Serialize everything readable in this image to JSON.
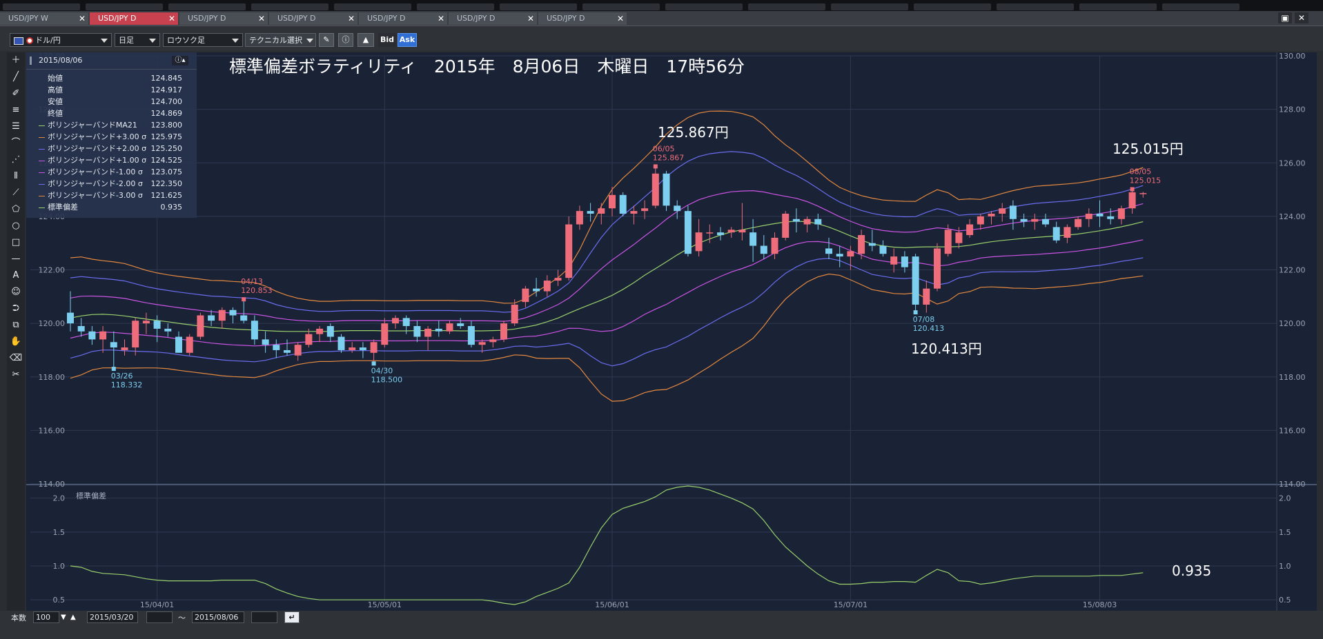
{
  "tabs": [
    {
      "label": "USD/JPY W",
      "active": false
    },
    {
      "label": "USD/JPY D",
      "active": true
    },
    {
      "label": "USD/JPY D",
      "active": false
    },
    {
      "label": "USD/JPY D",
      "active": false
    },
    {
      "label": "USD/JPY D",
      "active": false
    },
    {
      "label": "USD/JPY D",
      "active": false
    },
    {
      "label": "USD/JPY D",
      "active": false
    }
  ],
  "toolbar": {
    "pair": "ドル/円",
    "period": "日足",
    "chart_style": "ロウソク足",
    "technical": "テクニカル選択",
    "bid": "Bid",
    "ask": "Ask"
  },
  "info": {
    "date": "2015/08/06",
    "rows": [
      {
        "label": "始値",
        "value": "124.845",
        "color": ""
      },
      {
        "label": "高値",
        "value": "124.917",
        "color": ""
      },
      {
        "label": "安値",
        "value": "124.700",
        "color": ""
      },
      {
        "label": "終値",
        "value": "124.869",
        "color": ""
      },
      {
        "label": "ボリンジャーバンドMA21",
        "value": "123.800",
        "color": "#9ad16b"
      },
      {
        "label": "ボリンジャーバンド+3.00 σ",
        "value": "125.975",
        "color": "#e68a3f"
      },
      {
        "label": "ボリンジャーバンド+2.00 σ",
        "value": "125.250",
        "color": "#6b6ef0"
      },
      {
        "label": "ボリンジャーバンド+1.00 σ",
        "value": "124.525",
        "color": "#cc55e6"
      },
      {
        "label": "ボリンジャーバンド-1.00 σ",
        "value": "123.075",
        "color": "#cc55e6"
      },
      {
        "label": "ボリンジャーバンド-2.00 σ",
        "value": "122.350",
        "color": "#6b6ef0"
      },
      {
        "label": "ボリンジャーバンド-3.00 σ",
        "value": "121.625",
        "color": "#e68a3f"
      },
      {
        "label": "標準偏差",
        "value": "0.935",
        "color": "#9ad16b"
      }
    ]
  },
  "headline": "標準偏差ボラティリティ　2015年　8月06日　木曜日　17時56分",
  "sub_label": "標準偏差",
  "callouts": {
    "high_big": "125.867円",
    "recent_big": "125.015円",
    "low_big": "120.413円",
    "sd_big": "0.935"
  },
  "bottom": {
    "count_label": "本数",
    "count_value": "100",
    "from_date": "2015/03/20",
    "tilde": "〜",
    "to_date": "2015/08/06"
  },
  "colors": {
    "up": "#ef6d7a",
    "down": "#7ccfee",
    "ma": "#9ad16b",
    "sigma3": "#e68a3f",
    "sigma2": "#6b6ef0",
    "sigma1": "#cc55e6",
    "bg": "#1a2236",
    "grid": "#2e3850"
  },
  "chart_data": [
    {
      "type": "candlestick",
      "title": "標準偏差ボラティリティ　2015年　8月06日　木曜日　17時56分",
      "ylim": [
        114,
        130
      ],
      "y_ticks": [
        "130.00",
        "128.00",
        "126.00",
        "124.00",
        "122.00",
        "120.00",
        "118.00",
        "116.00",
        "114.00"
      ],
      "x_ticks": [
        {
          "index": 8,
          "label": "15/04/01"
        },
        {
          "index": 29,
          "label": "15/05/01"
        },
        {
          "index": 50,
          "label": "15/06/01"
        },
        {
          "index": 72,
          "label": "15/07/01"
        },
        {
          "index": 95,
          "label": "15/08/03"
        }
      ],
      "ohlc": [
        [
          120.4,
          121.2,
          119.7,
          120.0
        ],
        [
          119.9,
          120.2,
          119.5,
          119.7
        ],
        [
          119.7,
          119.9,
          119.2,
          119.4
        ],
        [
          119.4,
          119.9,
          118.9,
          119.7
        ],
        [
          119.3,
          119.7,
          118.3,
          119.1
        ],
        [
          119.0,
          119.4,
          118.8,
          119.1
        ],
        [
          119.1,
          120.2,
          118.8,
          120.1
        ],
        [
          120.0,
          120.4,
          119.6,
          120.1
        ],
        [
          120.1,
          120.3,
          119.3,
          119.8
        ],
        [
          119.8,
          120.0,
          119.5,
          119.7
        ],
        [
          119.5,
          119.7,
          118.9,
          118.9
        ],
        [
          118.9,
          119.6,
          118.8,
          119.5
        ],
        [
          119.5,
          120.4,
          119.4,
          120.3
        ],
        [
          120.3,
          120.5,
          119.9,
          120.1
        ],
        [
          120.1,
          120.6,
          119.8,
          120.5
        ],
        [
          120.5,
          120.6,
          120.0,
          120.3
        ],
        [
          120.3,
          120.9,
          120.0,
          120.1
        ],
        [
          120.1,
          120.3,
          119.2,
          119.4
        ],
        [
          119.4,
          119.7,
          118.9,
          119.2
        ],
        [
          119.2,
          119.4,
          118.7,
          119.0
        ],
        [
          119.0,
          119.4,
          118.8,
          118.9
        ],
        [
          118.8,
          119.3,
          118.6,
          119.2
        ],
        [
          119.2,
          119.8,
          119.1,
          119.6
        ],
        [
          119.6,
          119.9,
          119.3,
          119.8
        ],
        [
          119.9,
          120.0,
          119.3,
          119.5
        ],
        [
          119.5,
          119.6,
          118.9,
          119.0
        ],
        [
          119.0,
          119.3,
          118.9,
          119.1
        ],
        [
          119.1,
          119.3,
          118.7,
          119.0
        ],
        [
          118.9,
          119.4,
          118.5,
          119.3
        ],
        [
          119.2,
          120.2,
          119.1,
          120.0
        ],
        [
          120.0,
          120.3,
          119.8,
          120.2
        ],
        [
          120.2,
          120.3,
          119.6,
          119.9
        ],
        [
          119.9,
          120.1,
          119.3,
          119.5
        ],
        [
          119.5,
          119.9,
          119.0,
          119.8
        ],
        [
          119.8,
          120.1,
          119.5,
          119.7
        ],
        [
          119.7,
          120.1,
          119.6,
          120.0
        ],
        [
          120.0,
          120.2,
          119.8,
          119.9
        ],
        [
          119.9,
          120.1,
          119.1,
          119.2
        ],
        [
          119.2,
          119.4,
          118.9,
          119.3
        ],
        [
          119.3,
          119.5,
          119.1,
          119.4
        ],
        [
          119.4,
          120.1,
          119.3,
          120.0
        ],
        [
          120.0,
          120.9,
          119.9,
          120.7
        ],
        [
          120.8,
          121.4,
          120.6,
          121.3
        ],
        [
          121.3,
          121.7,
          121.0,
          121.2
        ],
        [
          121.2,
          121.8,
          121.0,
          121.6
        ],
        [
          121.6,
          122.0,
          121.4,
          121.7
        ],
        [
          121.7,
          124.0,
          121.6,
          123.7
        ],
        [
          123.7,
          124.4,
          123.5,
          124.2
        ],
        [
          124.2,
          124.5,
          123.8,
          124.1
        ],
        [
          124.1,
          124.5,
          123.7,
          124.3
        ],
        [
          124.3,
          125.1,
          124.0,
          124.8
        ],
        [
          124.8,
          124.9,
          124.0,
          124.1
        ],
        [
          124.1,
          124.4,
          123.7,
          124.2
        ],
        [
          124.2,
          124.6,
          123.9,
          124.3
        ],
        [
          124.4,
          125.867,
          124.3,
          125.6
        ],
        [
          125.6,
          125.7,
          124.2,
          124.4
        ],
        [
          124.4,
          124.6,
          123.9,
          124.2
        ],
        [
          124.2,
          124.4,
          122.5,
          122.6
        ],
        [
          122.7,
          123.9,
          122.5,
          123.4
        ],
        [
          123.4,
          123.7,
          123.0,
          123.4
        ],
        [
          123.4,
          123.6,
          123.1,
          123.3
        ],
        [
          123.4,
          123.6,
          123.2,
          123.5
        ],
        [
          123.4,
          124.5,
          123.1,
          123.5
        ],
        [
          123.4,
          123.9,
          122.3,
          122.9
        ],
        [
          122.9,
          123.3,
          122.4,
          122.6
        ],
        [
          122.6,
          123.4,
          122.4,
          123.2
        ],
        [
          123.2,
          124.2,
          123.1,
          124.1
        ],
        [
          123.9,
          124.3,
          123.4,
          123.8
        ],
        [
          123.7,
          124.0,
          123.4,
          123.9
        ],
        [
          123.9,
          124.1,
          123.5,
          123.7
        ],
        [
          122.8,
          123.2,
          122.4,
          122.6
        ],
        [
          122.6,
          122.9,
          122.1,
          122.5
        ],
        [
          122.5,
          122.9,
          122.0,
          122.7
        ],
        [
          122.6,
          123.5,
          122.4,
          123.3
        ],
        [
          123.0,
          123.5,
          122.7,
          122.9
        ],
        [
          122.9,
          123.1,
          122.5,
          122.6
        ],
        [
          122.2,
          122.8,
          121.9,
          122.5
        ],
        [
          122.5,
          122.7,
          121.9,
          122.1
        ],
        [
          122.5,
          122.6,
          120.413,
          120.7
        ],
        [
          120.7,
          121.6,
          120.4,
          121.3
        ],
        [
          121.3,
          123.0,
          121.2,
          122.8
        ],
        [
          122.6,
          123.7,
          122.5,
          123.5
        ],
        [
          123.0,
          123.6,
          122.8,
          123.4
        ],
        [
          123.3,
          123.9,
          123.2,
          123.7
        ],
        [
          123.7,
          124.1,
          123.5,
          124.0
        ],
        [
          124.0,
          124.2,
          123.7,
          124.1
        ],
        [
          124.1,
          124.5,
          123.8,
          124.3
        ],
        [
          124.4,
          124.6,
          123.5,
          123.9
        ],
        [
          123.9,
          124.1,
          123.6,
          123.8
        ],
        [
          123.8,
          124.1,
          123.5,
          123.9
        ],
        [
          123.9,
          124.1,
          123.6,
          123.7
        ],
        [
          123.6,
          123.8,
          123.0,
          123.1
        ],
        [
          123.2,
          123.7,
          123.0,
          123.6
        ],
        [
          123.6,
          124.0,
          123.5,
          123.9
        ],
        [
          123.9,
          124.3,
          123.6,
          124.1
        ],
        [
          124.1,
          124.6,
          123.6,
          124.0
        ],
        [
          124.0,
          124.3,
          123.7,
          123.9
        ],
        [
          123.9,
          124.4,
          123.7,
          124.3
        ],
        [
          124.3,
          125.015,
          124.1,
          124.9
        ],
        [
          124.845,
          124.917,
          124.7,
          124.869
        ]
      ],
      "bands": {
        "ma21": [
          120.2,
          120.28,
          120.33,
          120.34,
          120.32,
          120.28,
          120.22,
          120.16,
          120.11,
          120.06,
          120.0,
          119.95,
          119.9,
          119.85,
          119.82,
          119.79,
          119.77,
          119.75,
          119.73,
          119.71,
          119.7,
          119.7,
          119.7,
          119.7,
          119.7,
          119.72,
          119.73,
          119.73,
          119.73,
          119.72,
          119.72,
          119.72,
          119.73,
          119.73,
          119.73,
          119.73,
          119.72,
          119.72,
          119.72,
          119.73,
          119.74,
          119.79,
          119.86,
          119.94,
          120.06,
          120.2,
          120.38,
          120.55,
          120.71,
          120.87,
          121.05,
          121.27,
          121.52,
          121.8,
          122.05,
          122.3,
          122.56,
          122.79,
          123.0,
          123.16,
          123.3,
          123.42,
          123.5,
          123.58,
          123.66,
          123.73,
          123.79,
          123.82,
          123.8,
          123.72,
          123.6,
          123.44,
          123.27,
          123.11,
          122.97,
          122.9,
          122.85,
          122.83,
          122.85,
          122.86,
          122.86,
          122.86,
          122.87,
          122.92,
          122.99,
          123.05,
          123.1,
          123.14,
          123.18,
          123.21,
          123.24,
          123.27,
          123.3,
          123.34,
          123.4,
          123.46,
          123.53,
          123.61,
          123.7,
          123.8
        ],
        "sd": [
          1.0,
          0.98,
          0.92,
          0.89,
          0.88,
          0.87,
          0.84,
          0.81,
          0.79,
          0.78,
          0.78,
          0.78,
          0.78,
          0.78,
          0.79,
          0.79,
          0.79,
          0.79,
          0.74,
          0.66,
          0.6,
          0.55,
          0.52,
          0.5,
          0.5,
          0.5,
          0.5,
          0.5,
          0.5,
          0.5,
          0.5,
          0.5,
          0.5,
          0.5,
          0.5,
          0.5,
          0.5,
          0.5,
          0.5,
          0.48,
          0.45,
          0.43,
          0.47,
          0.55,
          0.61,
          0.67,
          0.75,
          0.98,
          1.28,
          1.56,
          1.76,
          1.85,
          1.9,
          1.95,
          2.02,
          2.12,
          2.16,
          2.18,
          2.16,
          2.12,
          2.06,
          2.0,
          1.93,
          1.84,
          1.67,
          1.46,
          1.28,
          1.14,
          1.0,
          0.88,
          0.78,
          0.73,
          0.73,
          0.74,
          0.76,
          0.76,
          0.77,
          0.77,
          0.76,
          0.86,
          0.95,
          0.9,
          0.78,
          0.77,
          0.73,
          0.75,
          0.78,
          0.81,
          0.83,
          0.85,
          0.85,
          0.85,
          0.85,
          0.85,
          0.85,
          0.86,
          0.86,
          0.86,
          0.88,
          0.9,
          0.935
        ]
      },
      "annotations": [
        {
          "index": 54,
          "date": "06/05",
          "price": "125.867",
          "kind": "high"
        },
        {
          "index": 98,
          "date": "08/05",
          "price": "125.015",
          "kind": "high"
        },
        {
          "index": 16,
          "date": "04/13",
          "price": "120.853",
          "kind": "high"
        },
        {
          "index": 4,
          "date": "03/26",
          "price": "118.332",
          "kind": "low"
        },
        {
          "index": 28,
          "date": "04/30",
          "price": "118.500",
          "kind": "low"
        },
        {
          "index": 78,
          "date": "07/08",
          "price": "120.413",
          "kind": "low"
        }
      ]
    },
    {
      "type": "line",
      "name": "標準偏差",
      "ylim": [
        0.4,
        2.2
      ],
      "y_ticks": [
        "2.0",
        "1.5",
        "1.0",
        "0.5"
      ],
      "last_value": 0.935
    }
  ]
}
